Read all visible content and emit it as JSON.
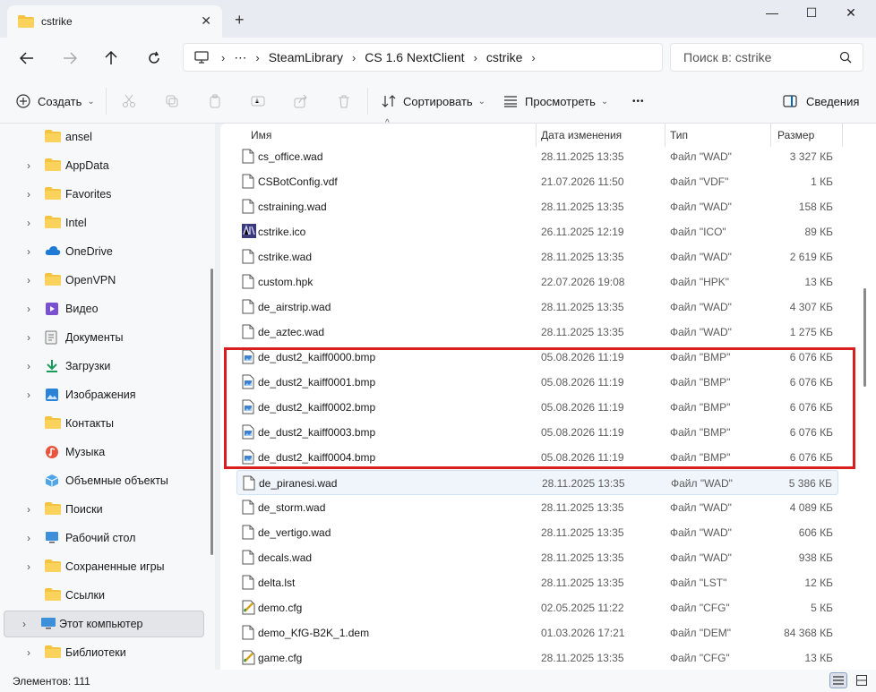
{
  "window": {
    "tab_title": "cstrike",
    "new_tab": "+",
    "close_tab": "✕",
    "minimize": "—",
    "maximize": "☐",
    "close": "✕"
  },
  "address": {
    "ellipsis": "⋯",
    "breadcrumbs": [
      "SteamLibrary",
      "CS 1.6 NextClient",
      "cstrike"
    ],
    "search_placeholder": "Поиск в: cstrike"
  },
  "toolbar": {
    "create": "Создать",
    "sort": "Сортировать",
    "view": "Просмотреть",
    "more": "•••",
    "details": "Сведения"
  },
  "sidebar": {
    "items": [
      {
        "label": "ansel",
        "icon": "folder-icon",
        "expandable": false
      },
      {
        "label": "AppData",
        "icon": "folder-icon",
        "expandable": true
      },
      {
        "label": "Favorites",
        "icon": "folder-icon",
        "expandable": true
      },
      {
        "label": "Intel",
        "icon": "folder-icon",
        "expandable": true
      },
      {
        "label": "OneDrive",
        "icon": "cloud-icon",
        "expandable": true
      },
      {
        "label": "OpenVPN",
        "icon": "folder-icon",
        "expandable": true
      },
      {
        "label": "Видео",
        "icon": "video-icon",
        "expandable": true
      },
      {
        "label": "Документы",
        "icon": "document-icon",
        "expandable": true
      },
      {
        "label": "Загрузки",
        "icon": "download-icon",
        "expandable": true
      },
      {
        "label": "Изображения",
        "icon": "image-icon",
        "expandable": true
      },
      {
        "label": "Контакты",
        "icon": "folder-icon",
        "expandable": false
      },
      {
        "label": "Музыка",
        "icon": "music-icon",
        "expandable": false
      },
      {
        "label": "Объемные объекты",
        "icon": "cube-icon",
        "expandable": false
      },
      {
        "label": "Поиски",
        "icon": "folder-icon",
        "expandable": true
      },
      {
        "label": "Рабочий стол",
        "icon": "desktop-icon",
        "expandable": true
      },
      {
        "label": "Сохраненные игры",
        "icon": "folder-icon",
        "expandable": true
      },
      {
        "label": "Ссылки",
        "icon": "folder-icon",
        "expandable": false
      },
      {
        "label": "Этот компьютер",
        "icon": "computer-icon",
        "expandable": true,
        "selected": true
      },
      {
        "label": "Библиотеки",
        "icon": "folder-icon",
        "expandable": true
      }
    ]
  },
  "columns": {
    "name": "Имя",
    "date": "Дата изменения",
    "type": "Тип",
    "size": "Размер"
  },
  "files": [
    {
      "name": "cs_office.wad",
      "date": "28.11.2025 13:35",
      "type": "Файл \"WAD\"",
      "size": "3 327 КБ",
      "icon": "file-icon"
    },
    {
      "name": "CSBotConfig.vdf",
      "date": "21.07.2026 11:50",
      "type": "Файл \"VDF\"",
      "size": "1 КБ",
      "icon": "file-icon"
    },
    {
      "name": "cstraining.wad",
      "date": "28.11.2025 13:35",
      "type": "Файл \"WAD\"",
      "size": "158 КБ",
      "icon": "file-icon"
    },
    {
      "name": "cstrike.ico",
      "date": "26.11.2025 12:19",
      "type": "Файл \"ICO\"",
      "size": "89 КБ",
      "icon": "ico-file-icon"
    },
    {
      "name": "cstrike.wad",
      "date": "28.11.2025 13:35",
      "type": "Файл \"WAD\"",
      "size": "2 619 КБ",
      "icon": "file-icon"
    },
    {
      "name": "custom.hpk",
      "date": "22.07.2026 19:08",
      "type": "Файл \"HPK\"",
      "size": "13 КБ",
      "icon": "file-icon"
    },
    {
      "name": "de_airstrip.wad",
      "date": "28.11.2025 13:35",
      "type": "Файл \"WAD\"",
      "size": "4 307 КБ",
      "icon": "file-icon"
    },
    {
      "name": "de_aztec.wad",
      "date": "28.11.2025 13:35",
      "type": "Файл \"WAD\"",
      "size": "1 275 КБ",
      "icon": "file-icon"
    },
    {
      "name": "de_dust2_kaiff0000.bmp",
      "date": "05.08.2026 11:19",
      "type": "Файл \"BMP\"",
      "size": "6 076 КБ",
      "icon": "bmp-file-icon"
    },
    {
      "name": "de_dust2_kaiff0001.bmp",
      "date": "05.08.2026 11:19",
      "type": "Файл \"BMP\"",
      "size": "6 076 КБ",
      "icon": "bmp-file-icon"
    },
    {
      "name": "de_dust2_kaiff0002.bmp",
      "date": "05.08.2026 11:19",
      "type": "Файл \"BMP\"",
      "size": "6 076 КБ",
      "icon": "bmp-file-icon"
    },
    {
      "name": "de_dust2_kaiff0003.bmp",
      "date": "05.08.2026 11:19",
      "type": "Файл \"BMP\"",
      "size": "6 076 КБ",
      "icon": "bmp-file-icon"
    },
    {
      "name": "de_dust2_kaiff0004.bmp",
      "date": "05.08.2026 11:19",
      "type": "Файл \"BMP\"",
      "size": "6 076 КБ",
      "icon": "bmp-file-icon"
    },
    {
      "name": "de_piranesi.wad",
      "date": "28.11.2025 13:35",
      "type": "Файл \"WAD\"",
      "size": "5 386 КБ",
      "icon": "file-icon",
      "highlighted": true
    },
    {
      "name": "de_storm.wad",
      "date": "28.11.2025 13:35",
      "type": "Файл \"WAD\"",
      "size": "4 089 КБ",
      "icon": "file-icon"
    },
    {
      "name": "de_vertigo.wad",
      "date": "28.11.2025 13:35",
      "type": "Файл \"WAD\"",
      "size": "606 КБ",
      "icon": "file-icon"
    },
    {
      "name": "decals.wad",
      "date": "28.11.2025 13:35",
      "type": "Файл \"WAD\"",
      "size": "938 КБ",
      "icon": "file-icon"
    },
    {
      "name": "delta.lst",
      "date": "28.11.2025 13:35",
      "type": "Файл \"LST\"",
      "size": "12 КБ",
      "icon": "file-icon"
    },
    {
      "name": "demo.cfg",
      "date": "02.05.2025 11:22",
      "type": "Файл \"CFG\"",
      "size": "5 КБ",
      "icon": "cfg-file-icon"
    },
    {
      "name": "demo_KfG-B2K_1.dem",
      "date": "01.03.2026 17:21",
      "type": "Файл \"DEM\"",
      "size": "84 368 КБ",
      "icon": "file-icon"
    },
    {
      "name": "game.cfg",
      "date": "28.11.2025 13:35",
      "type": "Файл \"CFG\"",
      "size": "13 КБ",
      "icon": "cfg-file-icon"
    }
  ],
  "status": {
    "count": "Элементов: 111"
  },
  "colors": {
    "accent": "#0067c0",
    "folder": "#f5c342",
    "annotation_border": "#d81e1e"
  }
}
